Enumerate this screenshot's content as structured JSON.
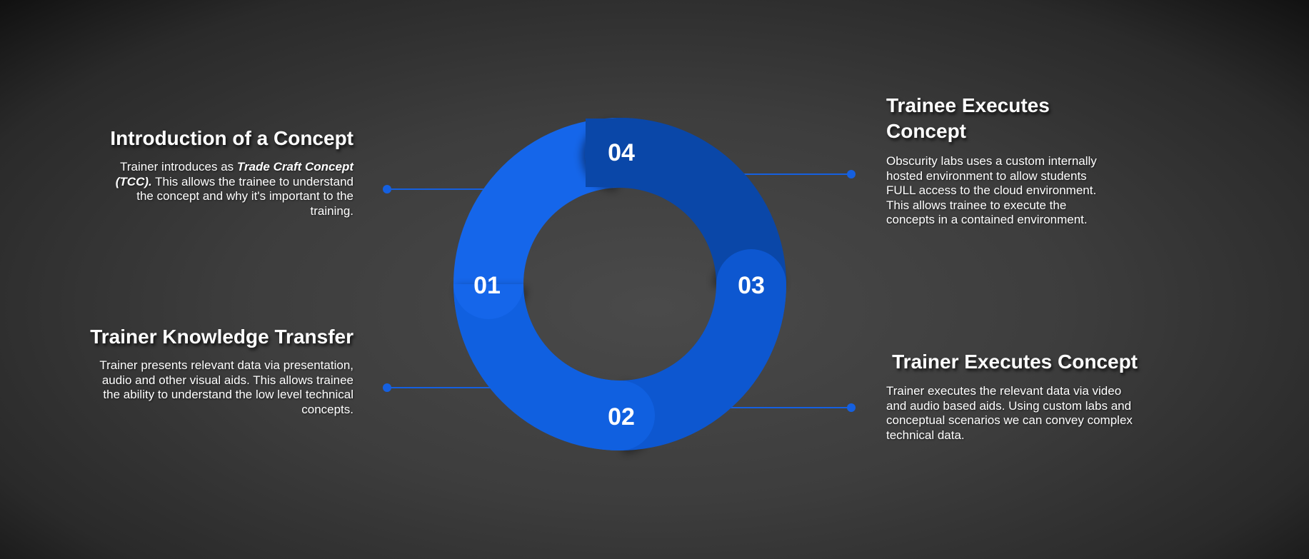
{
  "steps": [
    {
      "number": "01",
      "title": "Introduction of a Concept",
      "desc_prefix": "Trainer introduces as ",
      "desc_emphasis": "Trade Craft Concept (TCC).",
      "desc_suffix": " This allows the trainee to understand the concept and why it's important to the training."
    },
    {
      "number": "02",
      "title": "Trainer Knowledge Transfer",
      "desc": "Trainer presents relevant data via presentation, audio and other visual aids. This allows trainee the ability to understand the low level technical concepts."
    },
    {
      "number": "03",
      "title": "Trainer Executes Concept",
      "desc": "Trainer executes the relevant data via video and audio based aids. Using custom labs and conceptual scenarios we can convey complex technical data."
    },
    {
      "number": "04",
      "title": "Trainee Executes Concept",
      "desc": "Obscurity labs uses a custom internally hosted environment to allow students FULL access to the cloud environment. This allows trainee to execute the concepts in a contained environment."
    }
  ],
  "colors": {
    "segment_01": "#1566ea",
    "segment_02": "#1060e0",
    "segment_03": "#0d57d0",
    "segment_04": "#0a47a8",
    "connector": "#1560e0"
  }
}
